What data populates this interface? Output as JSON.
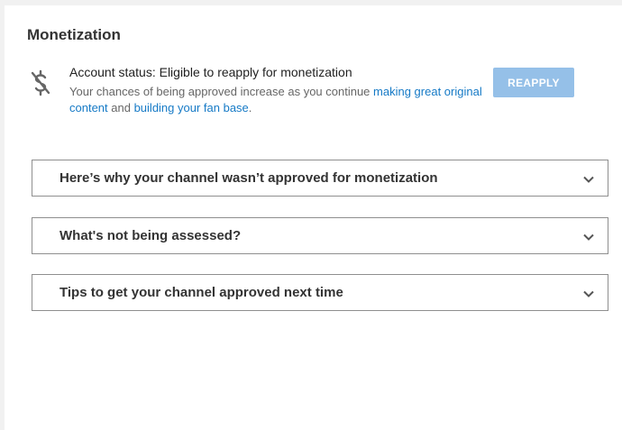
{
  "section": {
    "title": "Monetization"
  },
  "status": {
    "icon": "no-monetization-icon",
    "line": "Account status: Eligible to reapply for monetization",
    "desc_prefix": "Your chances of being approved increase as you continue ",
    "link1": "making great original content",
    "desc_middle": " and ",
    "link2": "building your fan base",
    "desc_suffix": ".",
    "link_color": "#167ac6"
  },
  "reapply_button": {
    "label": "REAPPLY",
    "color": "#95c0e8"
  },
  "accordions": [
    {
      "label": "Here’s why your channel wasn’t approved for monetization",
      "icon": "chevron-down-icon"
    },
    {
      "label": "What's not being assessed?",
      "icon": "chevron-down-icon"
    },
    {
      "label": "Tips to get your channel approved next time",
      "icon": "chevron-down-icon"
    }
  ]
}
